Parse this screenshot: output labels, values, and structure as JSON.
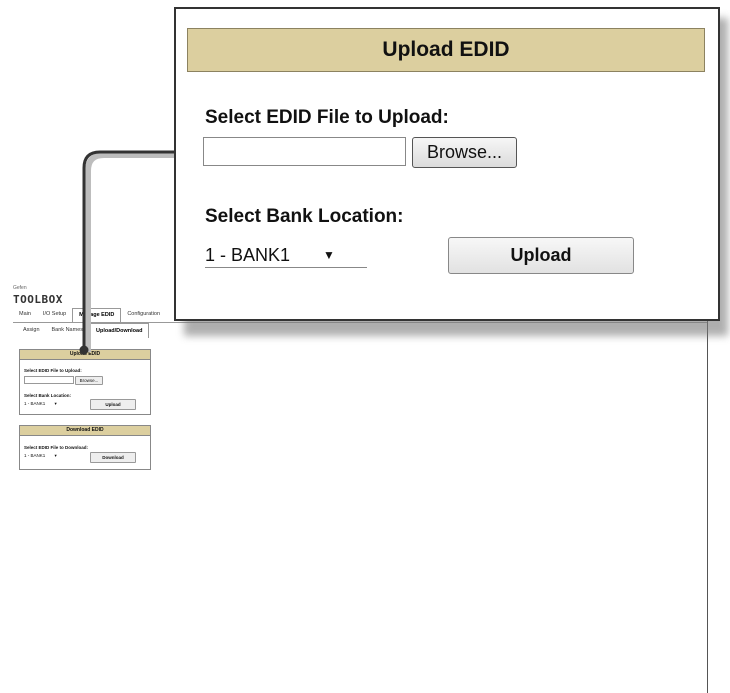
{
  "app": {
    "brand": "Gefen",
    "product": "TOOLBOX"
  },
  "main_tabs": [
    "Main",
    "I/O Setup",
    "Manage EDID",
    "Configuration"
  ],
  "sub_tabs": [
    "Assign",
    "Bank Names",
    "Upload/Download"
  ],
  "upload_panel": {
    "title": "Upload EDID",
    "file_label": "Select EDID File to Upload:",
    "file_value": "",
    "browse_label": "Browse...",
    "bank_label": "Select Bank Location:",
    "bank_selected": "1 - BANK1",
    "upload_label": "Upload"
  },
  "download_panel": {
    "title": "Download EDID",
    "file_label": "Select EDID File to Download:",
    "bank_selected": "1 - BANK1",
    "download_label": "Download"
  },
  "colors": {
    "panel_header": "#dccf9f",
    "connector": "#333333"
  }
}
